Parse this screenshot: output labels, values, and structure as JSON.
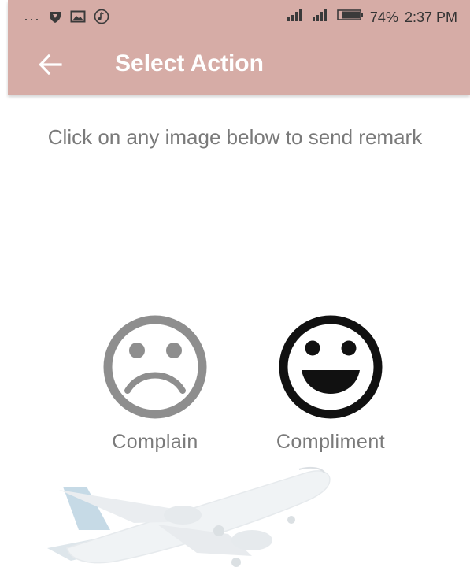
{
  "status_bar": {
    "dots": "···",
    "battery_percent": "74%",
    "time": "2:37 PM",
    "icons": [
      "shield-icon",
      "image-icon",
      "music-icon",
      "signal-icon",
      "signal-icon",
      "battery-icon"
    ]
  },
  "app_bar": {
    "title": "Select Action",
    "back_icon": "arrow-left-icon"
  },
  "main": {
    "instruction": "Click on any image below to send remark",
    "options": [
      {
        "label": "Complain",
        "icon": "sad-face-icon"
      },
      {
        "label": "Compliment",
        "icon": "happy-face-icon"
      }
    ]
  },
  "colors": {
    "app_bar_bg": "#d6aca6",
    "title_text": "#ffffff",
    "body_text": "#7a7a7a",
    "sad_face": "#8e8e8e",
    "happy_face": "#111111"
  }
}
